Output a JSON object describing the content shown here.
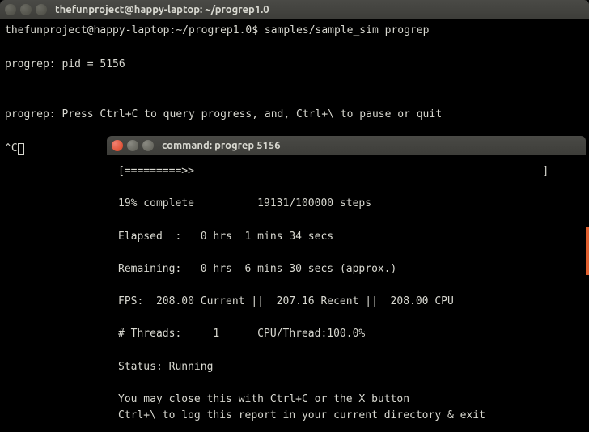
{
  "main_window": {
    "title": "thefunproject@happy-laptop: ~/progrep1.0",
    "prompt": "thefunproject@happy-laptop:~/progrep1.0$ ",
    "command": "samples/sample_sim progrep",
    "line_pid": "progrep: pid = 5156",
    "line_instructions": "progrep: Press Ctrl+C to query progress, and, Ctrl+\\ to pause or quit",
    "ctrlc": "^C"
  },
  "popup": {
    "title": "command: progrep 5156",
    "progress_bar": "[=========>>                                                       ]",
    "percent_line": "19% complete          19131/100000 steps",
    "elapsed": "Elapsed  :   0 hrs  1 mins 34 secs",
    "remaining": "Remaining:   0 hrs  6 mins 30 secs (approx.)",
    "fps": "FPS:  208.00 Current ||  207.16 Recent ||  208.00 CPU",
    "threads": "# Threads:     1      CPU/Thread:100.0%",
    "status": "Status: Running",
    "close_hint1": "You may close this with Ctrl+C or the X button",
    "close_hint2": "Ctrl+\\ to log this report in your current directory & exit"
  }
}
